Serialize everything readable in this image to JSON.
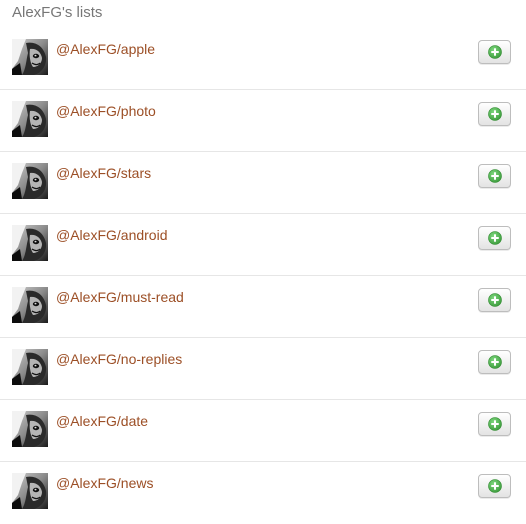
{
  "header": {
    "title": "AlexFG's lists"
  },
  "lists": [
    {
      "name": "@AlexFG/apple"
    },
    {
      "name": "@AlexFG/photo"
    },
    {
      "name": "@AlexFG/stars"
    },
    {
      "name": "@AlexFG/android"
    },
    {
      "name": "@AlexFG/must-read"
    },
    {
      "name": "@AlexFG/no-replies"
    },
    {
      "name": "@AlexFG/date"
    },
    {
      "name": "@AlexFG/news"
    }
  ],
  "icons": {
    "avatar": "avatar-photo",
    "follow": "plus-circle-icon"
  },
  "colors": {
    "link": "#9c4f26",
    "title": "#777777",
    "plus_green": "#4cae4c",
    "divider": "#e6e6e6"
  }
}
